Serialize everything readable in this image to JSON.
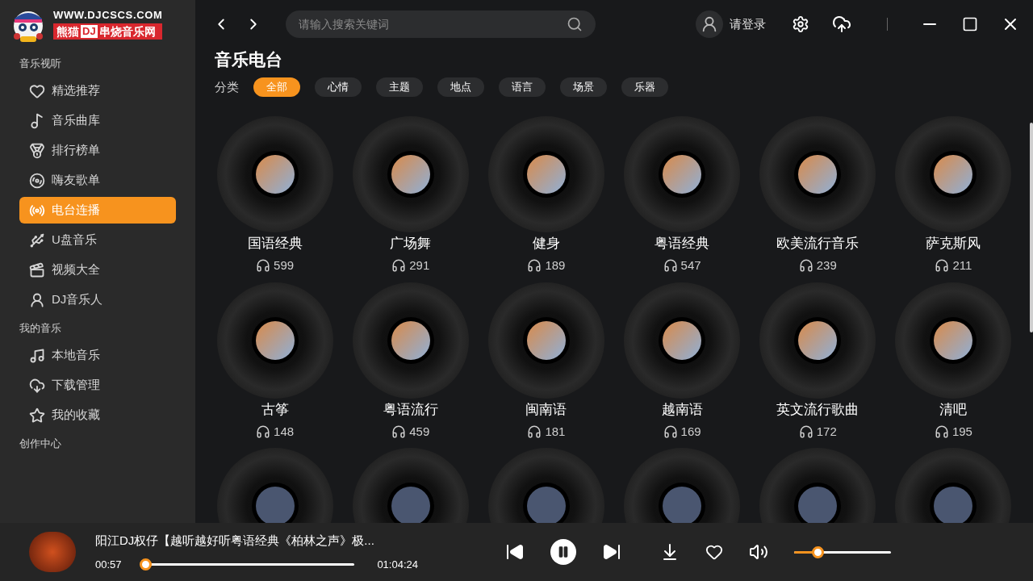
{
  "logo": {
    "url": "WWW.DJCSCS.COM",
    "name_before": "熊猫",
    "name_badge": "DJ",
    "name_after": "串烧音乐网"
  },
  "sidebar": {
    "sections": [
      {
        "title": "音乐视听",
        "items": [
          {
            "label": "精选推荐",
            "selected": false
          },
          {
            "label": "音乐曲库",
            "selected": false
          },
          {
            "label": "排行榜单",
            "selected": false
          },
          {
            "label": "嗨友歌单",
            "selected": false
          },
          {
            "label": "电台连播",
            "selected": true
          },
          {
            "label": "U盘音乐",
            "selected": false
          },
          {
            "label": "视频大全",
            "selected": false
          },
          {
            "label": "DJ音乐人",
            "selected": false
          }
        ]
      },
      {
        "title": "我的音乐",
        "items": [
          {
            "label": "本地音乐",
            "selected": false
          },
          {
            "label": "下载管理",
            "selected": false
          },
          {
            "label": "我的收藏",
            "selected": false
          }
        ]
      },
      {
        "title": "创作中心"
      }
    ]
  },
  "topbar": {
    "search": {
      "placeholder": "请输入搜索关键词"
    },
    "login": "请登录"
  },
  "page": {
    "title": "音乐电台",
    "filter_label": "分类",
    "filters": [
      {
        "label": "全部",
        "selected": true
      },
      {
        "label": "心情",
        "selected": false
      },
      {
        "label": "主题",
        "selected": false
      },
      {
        "label": "地点",
        "selected": false
      },
      {
        "label": "语言",
        "selected": false
      },
      {
        "label": "场景",
        "selected": false
      },
      {
        "label": "乐器",
        "selected": false
      }
    ]
  },
  "stations": [
    {
      "kind": "full",
      "name": "国语经典",
      "plays": "599"
    },
    {
      "kind": "full",
      "name": "广场舞",
      "plays": "291"
    },
    {
      "kind": "full",
      "name": "健身",
      "plays": "189"
    },
    {
      "kind": "full",
      "name": "粤语经典",
      "plays": "547"
    },
    {
      "kind": "full",
      "name": "欧美流行音乐",
      "plays": "239"
    },
    {
      "kind": "full",
      "name": "萨克斯风",
      "plays": "211"
    },
    {
      "kind": "full",
      "name": "古筝",
      "plays": "148"
    },
    {
      "kind": "full",
      "name": "粤语流行",
      "plays": "459"
    },
    {
      "kind": "full",
      "name": "闽南语",
      "plays": "181"
    },
    {
      "kind": "full",
      "name": "越南语",
      "plays": "169"
    },
    {
      "kind": "full",
      "name": "英文流行歌曲",
      "plays": "172"
    },
    {
      "kind": "full",
      "name": "清吧",
      "plays": "195"
    },
    {
      "kind": "partial"
    },
    {
      "kind": "partial"
    },
    {
      "kind": "partial"
    },
    {
      "kind": "partial"
    },
    {
      "kind": "partial"
    },
    {
      "kind": "partial"
    }
  ],
  "player": {
    "title": "阳江DJ权仔【越听越好听粤语经典《柏林之声》极...",
    "elapsed": "00:57",
    "duration": "01:04:24",
    "playing": true,
    "progress": {
      "level": 0.01
    },
    "volume": {
      "level": 0.25
    }
  }
}
